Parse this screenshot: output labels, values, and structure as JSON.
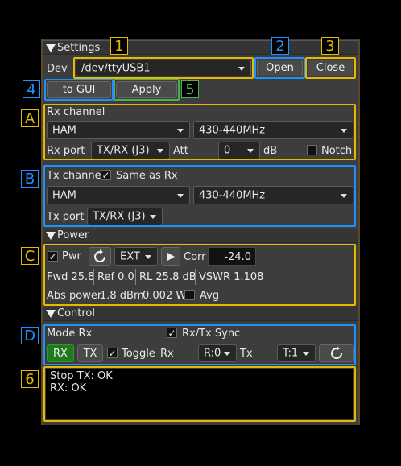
{
  "tags": {
    "t1": "1",
    "t2": "2",
    "t3": "3",
    "t4": "4",
    "t5": "5",
    "t6": "6",
    "tA": "A",
    "tB": "B",
    "tC": "C",
    "tD": "D"
  },
  "settings": {
    "title": "Settings",
    "dev_label": "Dev",
    "dev_value": "/dev/ttyUSB1",
    "open": "Open",
    "close": "Close",
    "to_gui": "to GUI",
    "apply": "Apply"
  },
  "rx": {
    "title": "Rx channel",
    "band": "HAM",
    "range": "430-440MHz",
    "port_label": "Rx port",
    "port": "TX/RX (J3)",
    "att_label": "Att",
    "att": "0",
    "db": "dB",
    "notch": "Notch",
    "notch_checked": false
  },
  "tx": {
    "title": "Tx channel",
    "same_as_rx": "Same as Rx",
    "same_checked": true,
    "band": "HAM",
    "range": "430-440MHz",
    "port_label": "Tx port",
    "port": "TX/RX (J3)"
  },
  "power": {
    "title": "Power",
    "pwr": "Pwr",
    "pwr_checked": true,
    "ext": "EXT",
    "corr_label": "Corr",
    "corr": "-24.0",
    "fwd": "Fwd 25.8",
    "ref": "Ref 0.0",
    "rl": "RL 25.8 dB",
    "vswr": "VSWR 1.108",
    "abs_label": "Abs power",
    "abs_dbm": "1.8 dBm",
    "abs_w": "0.002 W",
    "avg": "Avg",
    "avg_checked": false
  },
  "control": {
    "title": "Control",
    "mode": "Mode Rx",
    "sync": "Rx/Tx Sync",
    "sync_checked": true,
    "rx_btn": "RX",
    "tx_btn": "TX",
    "toggle": "Toggle",
    "toggle_checked": true,
    "rx_label": "Rx",
    "rx_val": "R:0",
    "tx_label": "Tx",
    "tx_val": "T:1"
  },
  "log": {
    "line1": "Stop TX: OK",
    "line2": "RX: OK"
  },
  "colors": {
    "yellow": "#e6b800",
    "blue": "#1e90ff",
    "green": "#4caf50",
    "rx_green": "#1f7a1f"
  }
}
